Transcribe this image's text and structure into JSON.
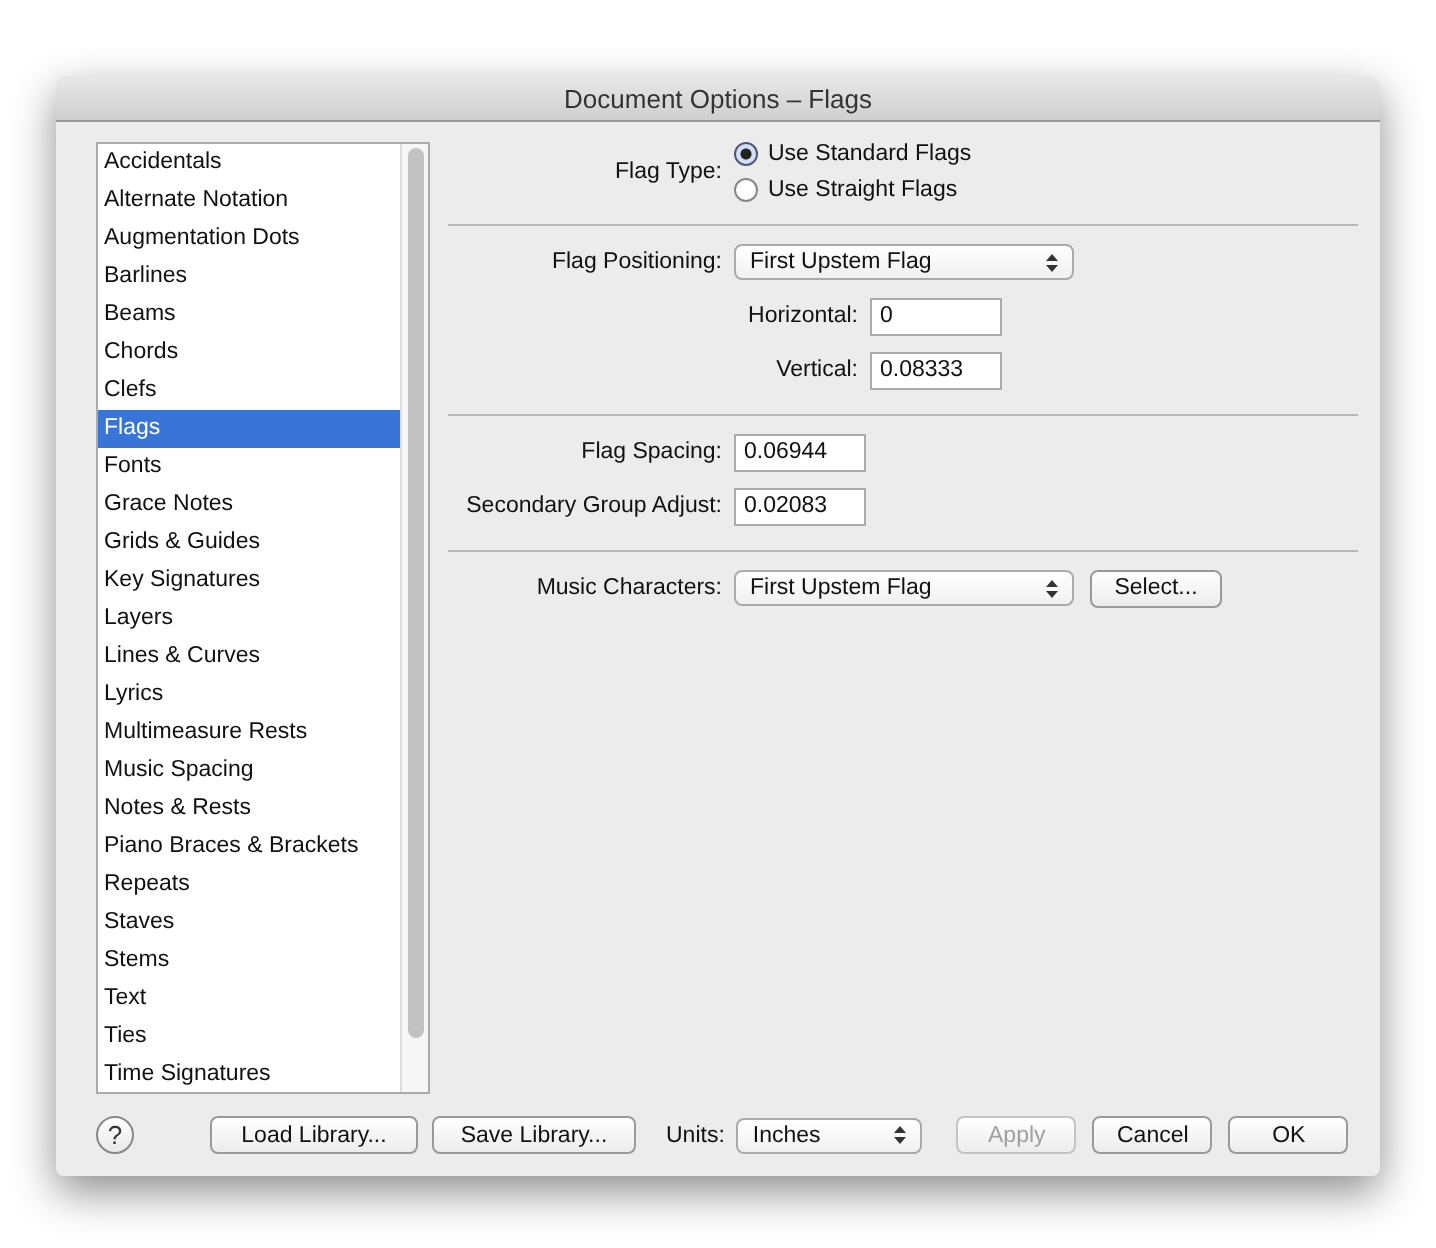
{
  "window": {
    "title": "Document Options – Flags"
  },
  "sidebar": {
    "items": [
      {
        "label": "Accidentals",
        "selected": false
      },
      {
        "label": "Alternate Notation",
        "selected": false
      },
      {
        "label": "Augmentation Dots",
        "selected": false
      },
      {
        "label": "Barlines",
        "selected": false
      },
      {
        "label": "Beams",
        "selected": false
      },
      {
        "label": "Chords",
        "selected": false
      },
      {
        "label": "Clefs",
        "selected": false
      },
      {
        "label": "Flags",
        "selected": true
      },
      {
        "label": "Fonts",
        "selected": false
      },
      {
        "label": "Grace Notes",
        "selected": false
      },
      {
        "label": "Grids & Guides",
        "selected": false
      },
      {
        "label": "Key Signatures",
        "selected": false
      },
      {
        "label": "Layers",
        "selected": false
      },
      {
        "label": "Lines & Curves",
        "selected": false
      },
      {
        "label": "Lyrics",
        "selected": false
      },
      {
        "label": "Multimeasure Rests",
        "selected": false
      },
      {
        "label": "Music Spacing",
        "selected": false
      },
      {
        "label": "Notes & Rests",
        "selected": false
      },
      {
        "label": "Piano Braces & Brackets",
        "selected": false
      },
      {
        "label": "Repeats",
        "selected": false
      },
      {
        "label": "Staves",
        "selected": false
      },
      {
        "label": "Stems",
        "selected": false
      },
      {
        "label": "Text",
        "selected": false
      },
      {
        "label": "Ties",
        "selected": false
      },
      {
        "label": "Time Signatures",
        "selected": false
      }
    ]
  },
  "flag_type": {
    "label": "Flag Type:",
    "options": [
      {
        "label": "Use Standard Flags",
        "selected": true
      },
      {
        "label": "Use Straight Flags",
        "selected": false
      }
    ]
  },
  "flag_positioning": {
    "label": "Flag Positioning:",
    "value": "First Upstem Flag",
    "horizontal": {
      "label": "Horizontal:",
      "value": "0"
    },
    "vertical": {
      "label": "Vertical:",
      "value": "0.08333"
    }
  },
  "flag_spacing": {
    "label": "Flag Spacing:",
    "value": "0.06944"
  },
  "secondary_group_adjust": {
    "label": "Secondary Group Adjust:",
    "value": "0.02083"
  },
  "music_characters": {
    "label": "Music Characters:",
    "value": "First Upstem Flag",
    "button": "Select..."
  },
  "footer": {
    "help": "?",
    "load": "Load Library...",
    "save": "Save Library...",
    "units_label": "Units:",
    "units": "Inches",
    "buttons": [
      {
        "label": "Apply",
        "disabled": true
      },
      {
        "label": "Cancel",
        "disabled": false
      },
      {
        "label": "OK",
        "disabled": false
      }
    ]
  }
}
